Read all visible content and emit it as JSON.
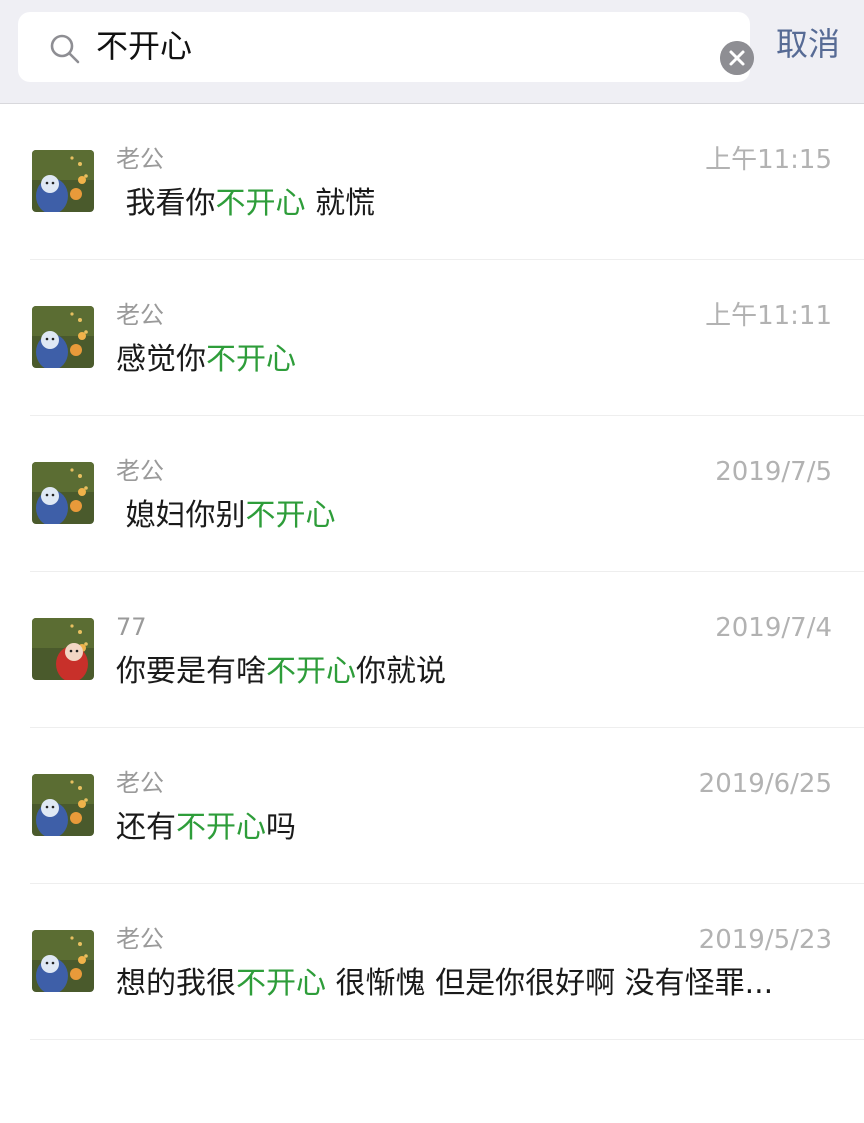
{
  "search": {
    "value": "不开心",
    "cancel_label": "取消"
  },
  "results": [
    {
      "avatar": "teletubby-blue",
      "name": "老公",
      "time": "上午11:15",
      "pre": " 我看你",
      "highlight": "不开心",
      "post": " 就慌"
    },
    {
      "avatar": "teletubby-blue",
      "name": "老公",
      "time": "上午11:11",
      "pre": "感觉你",
      "highlight": "不开心",
      "post": ""
    },
    {
      "avatar": "teletubby-blue",
      "name": "老公",
      "time": "2019/7/5",
      "pre": " 媳妇你别",
      "highlight": "不开心",
      "post": ""
    },
    {
      "avatar": "teletubby-red",
      "name": "77",
      "time": "2019/7/4",
      "pre": "你要是有啥",
      "highlight": "不开心",
      "post": "你就说"
    },
    {
      "avatar": "teletubby-blue",
      "name": "老公",
      "time": "2019/6/25",
      "pre": "还有",
      "highlight": "不开心",
      "post": "吗"
    },
    {
      "avatar": "teletubby-blue",
      "name": "老公",
      "time": "2019/5/23",
      "pre": "想的我很",
      "highlight": "不开心",
      "post": " 很惭愧 但是你很好啊 没有怪罪..."
    }
  ],
  "colors": {
    "highlight": "#2e9d3a",
    "cancel": "#576b95",
    "search_bar_bg": "#efeff4"
  }
}
